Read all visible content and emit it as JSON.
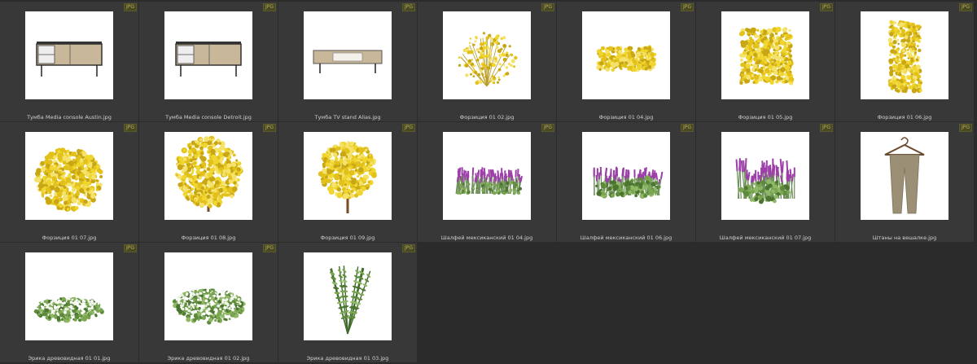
{
  "badge_label": "JPG",
  "items": [
    {
      "name": "Тумба Media console Austin.jpg",
      "kind": "console-icon"
    },
    {
      "name": "Тумба Media console Detroit.jpg",
      "kind": "console-icon"
    },
    {
      "name": "Тумба TV stand Alias.jpg",
      "kind": "tv-stand-icon"
    },
    {
      "name": "Форзиция 01 02.jpg",
      "kind": "forsythia-shrub-icon"
    },
    {
      "name": "Форзиция 01 04.jpg",
      "kind": "hedge-low-icon"
    },
    {
      "name": "Форзиция 01 05.jpg",
      "kind": "hedge-cube-icon"
    },
    {
      "name": "Форзиция 01 06.jpg",
      "kind": "hedge-tall-icon"
    },
    {
      "name": "Форзиция 01 07.jpg",
      "kind": "bush-round-icon"
    },
    {
      "name": "Форзиция 01 08.jpg",
      "kind": "bush-globe-icon"
    },
    {
      "name": "Форзиция 01 09.jpg",
      "kind": "tree-globe-icon"
    },
    {
      "name": "Шалфей мексиканский 01 04.jpg",
      "kind": "salvia-row-icon"
    },
    {
      "name": "Шалфей мексиканский 01 06.jpg",
      "kind": "salvia-group-icon"
    },
    {
      "name": "Шалфей мексиканский 01 07.jpg",
      "kind": "salvia-bush-icon"
    },
    {
      "name": "Штаны на вешалке.jpg",
      "kind": "pants-hanger-icon"
    },
    {
      "name": "Эрика древовидная 01 01.jpg",
      "kind": "erica-low-icon"
    },
    {
      "name": "Эрика древовидная 01 02.jpg",
      "kind": "erica-mound-icon"
    },
    {
      "name": "Эрика древовидная 01 03.jpg",
      "kind": "erica-upright-icon"
    }
  ],
  "colors": {
    "background": "#2b2b2b",
    "cell": "#383838",
    "badge_bg": "#4a4a22",
    "badge_text": "#b5ad62",
    "forsythia": "#e2c21a",
    "salvia": "#9c3fa8",
    "leaf": "#5d8b3a",
    "wood": "#c9b79a"
  }
}
